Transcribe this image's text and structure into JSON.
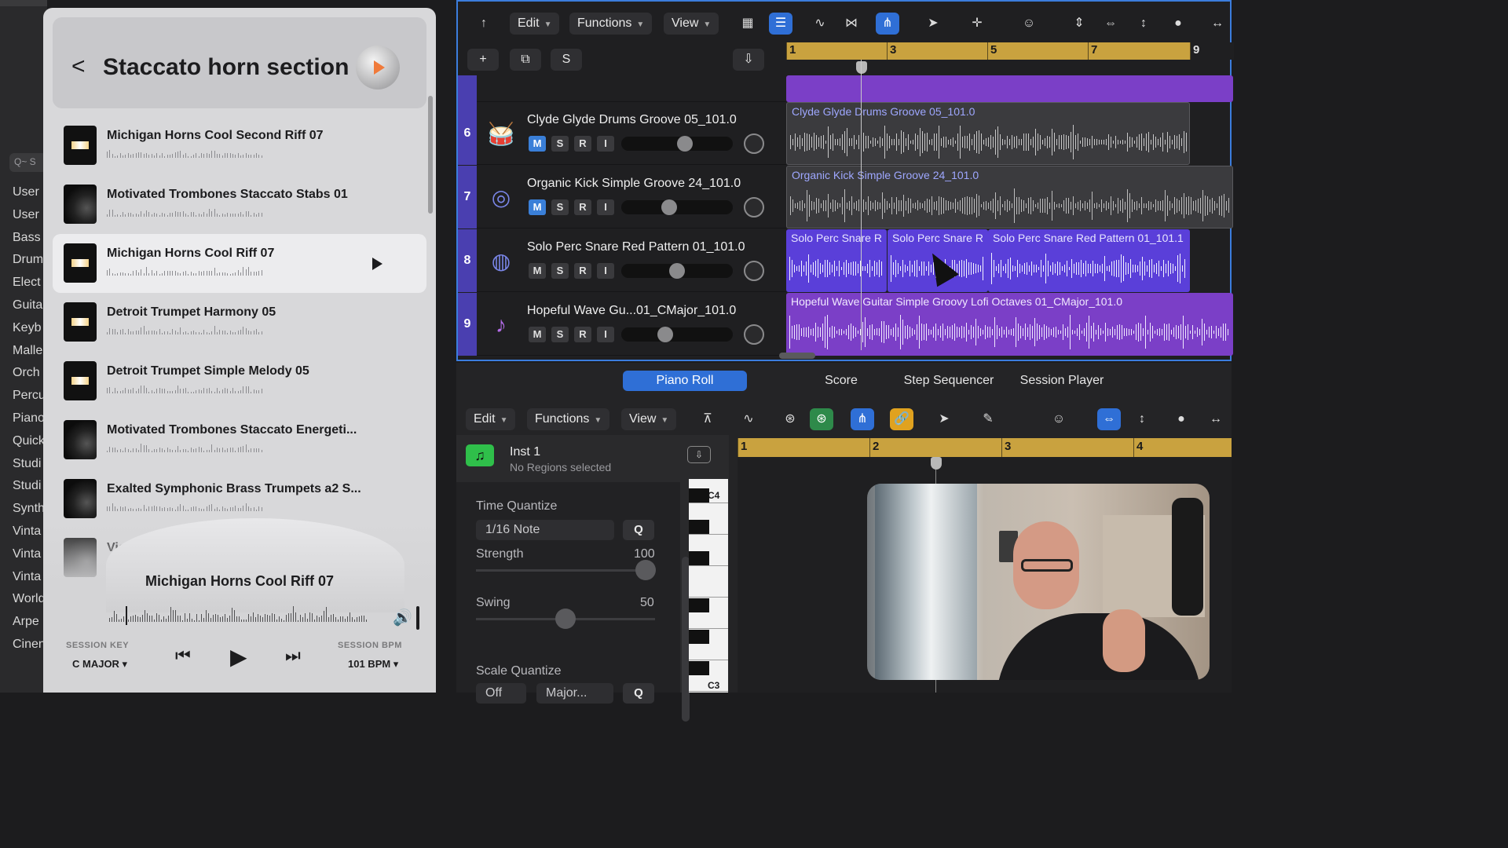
{
  "left_sidebar": {
    "search_placeholder": "Q~ S",
    "items": [
      "User",
      "User",
      "Bass",
      "Drum",
      "Elect",
      "Guita",
      "Keyb",
      "Malle",
      "Orch",
      "Percu",
      "Piano",
      "Quick",
      "Studi",
      "Studi",
      "Synth",
      "Vinta",
      "Vinta",
      "Vinta",
      "World",
      "Arpe",
      "Cinen"
    ]
  },
  "browser": {
    "back_label": "<",
    "title": "Staccato horn section",
    "items": [
      {
        "name": "Michigan Horns Cool Second Riff 07",
        "art": "mich"
      },
      {
        "name": "Motivated Trombones Staccato Stabs 01",
        "art": "swirl"
      },
      {
        "name": "Michigan Horns Cool Riff 07",
        "art": "mich",
        "selected": true
      },
      {
        "name": "Detroit Trumpet Harmony 05",
        "art": "mich"
      },
      {
        "name": "Detroit Trumpet Simple Melody 05",
        "art": "mich"
      },
      {
        "name": "Motivated Trombones Staccato Energeti...",
        "art": "swirl"
      },
      {
        "name": "Exalted Symphonic Brass Trumpets a2 S...",
        "art": "swirl"
      },
      {
        "name": "Victorious S...mble St...",
        "art": "swirl"
      }
    ],
    "player": {
      "now_playing": "Michigan Horns Cool Riff 07",
      "session_key_label": "SESSION KEY",
      "session_key_value": "C MAJOR ▾",
      "session_bpm_label": "SESSION BPM",
      "session_bpm_value": "101 BPM ▾"
    }
  },
  "tracks_window": {
    "toolbar": {
      "edit": "Edit",
      "functions": "Functions",
      "view": "View"
    },
    "row2": {
      "add": "+",
      "dup": "⧉",
      "s": "S"
    },
    "ruler": [
      "1",
      "3",
      "5",
      "7",
      "9"
    ],
    "tracks": [
      {
        "num": "6",
        "name": "Clyde Glyde Drums Groove 05_101.0",
        "icon": "drum-kit-icon",
        "m_on": true,
        "fader": 0.58
      },
      {
        "num": "7",
        "name": "Organic Kick Simple Groove 24_101.0",
        "icon": "kick-drum-icon",
        "m_on": true,
        "fader": 0.42
      },
      {
        "num": "8",
        "name": "Solo Perc Snare Red Pattern 01_101.0",
        "icon": "snare-drum-icon",
        "m_on": false,
        "fader": 0.5
      },
      {
        "num": "9",
        "name": "Hopeful Wave Gu...01_CMajor_101.0",
        "icon": "guitar-icon",
        "m_on": false,
        "fader": 0.38
      }
    ],
    "regions": {
      "r6": "Clyde Glyde Drums Groove 05_101.0",
      "r7": "Organic Kick Simple Groove 24_101.0",
      "r8a": "Solo Perc Snare R",
      "r8b": "Solo Perc Snare R",
      "r8c": "Solo Perc Snare Red Pattern 01_101.1",
      "r9": "Hopeful Wave Guitar Simple Groovy Lofi Octaves 01_CMajor_101.0"
    }
  },
  "editor": {
    "tabs": [
      "Piano Roll",
      "Score",
      "Step Sequencer",
      "Session Player"
    ],
    "toolbar": {
      "edit": "Edit",
      "functions": "Functions",
      "view": "View"
    },
    "inst_name": "Inst 1",
    "inst_sub": "No Regions selected",
    "time_quantize_label": "Time Quantize",
    "time_quantize_value": "1/16 Note",
    "q_button": "Q",
    "strength_label": "Strength",
    "strength_value": "100",
    "swing_label": "Swing",
    "swing_value": "50",
    "scale_quantize_label": "Scale Quantize",
    "scale_off": "Off",
    "scale_mode": "Major...",
    "key_c4": "C4",
    "key_c3": "C3",
    "roll_ruler": [
      "1",
      "2",
      "3",
      "4"
    ]
  }
}
